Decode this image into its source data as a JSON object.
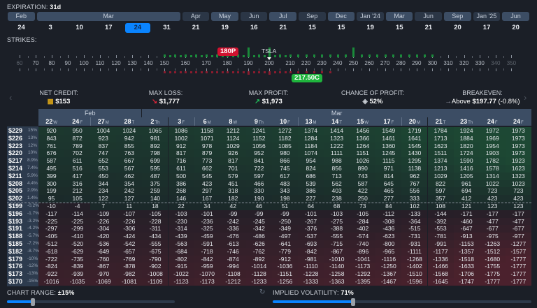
{
  "expiration": {
    "label": "EXPIRATION:",
    "value": "31d",
    "selected_index": 4,
    "months": [
      {
        "label": "Feb",
        "span": 1,
        "shade": "light"
      },
      {
        "label": "Mar",
        "span": 5,
        "shade": "light"
      },
      {
        "label": "Apr",
        "span": 1,
        "shade": "dark"
      },
      {
        "label": "May",
        "span": 1,
        "shade": "light"
      },
      {
        "label": "Jun",
        "span": 1,
        "shade": "dark"
      },
      {
        "label": "Jul",
        "span": 1,
        "shade": "light"
      },
      {
        "label": "Sep",
        "span": 1,
        "shade": "dark"
      },
      {
        "label": "Dec",
        "span": 1,
        "shade": "light"
      },
      {
        "label": "Jan '24",
        "span": 1,
        "shade": "dark"
      },
      {
        "label": "Mar",
        "span": 1,
        "shade": "light"
      },
      {
        "label": "Jun",
        "span": 1,
        "shade": "dark"
      },
      {
        "label": "Sep",
        "span": 1,
        "shade": "light"
      },
      {
        "label": "Jan '25",
        "span": 1,
        "shade": "dark"
      },
      {
        "label": "Jun",
        "span": 1,
        "shade": "light"
      }
    ],
    "dates": [
      "24",
      "3",
      "10",
      "17",
      "24",
      "31",
      "21",
      "19",
      "16",
      "21",
      "15",
      "15",
      "19",
      "15",
      "21",
      "20",
      "17",
      "20"
    ]
  },
  "strikes": {
    "label": "STRIKES:",
    "ticker": "TSLA",
    "put_tag": "180P",
    "call_tag": "217.50C",
    "ruler": [
      "60",
      "70",
      "80",
      "90",
      "100",
      "110",
      "120",
      "130",
      "140",
      "150",
      "160",
      "170",
      "180",
      "190",
      "200",
      "210",
      "220",
      "230",
      "240",
      "250",
      "260",
      "270",
      "280",
      "290",
      "300",
      "310",
      "320",
      "330",
      "340",
      "350"
    ]
  },
  "stats": [
    {
      "title": "NET CREDIT:",
      "value": "$153",
      "icon": "coins-icon"
    },
    {
      "title": "MAX LOSS:",
      "value": "$1,777",
      "icon": "arrow-down-right-icon"
    },
    {
      "title": "MAX PROFIT:",
      "value": "$1,973",
      "icon": "arrow-up-right-icon"
    },
    {
      "title": "CHANCE OF PROFIT:",
      "value": "52%",
      "icon": "dice-icon"
    },
    {
      "title": "BREAKEVEN:",
      "prefix": "Above",
      "value": "$197.77",
      "suffix": "(-0.8%)",
      "icon": "arrow-right-icon"
    }
  ],
  "colors": {
    "accent": "#0a84ff",
    "profit": "#22c55e",
    "loss": "#dc2626",
    "put_tag": "#d0122f",
    "call_tag": "#1fb53d"
  },
  "table": {
    "months": [
      {
        "label": "Feb",
        "cols": 4
      },
      {
        "label": "Mar",
        "cols": 15
      }
    ],
    "columns": [
      {
        "d": "22",
        "w": "W"
      },
      {
        "d": "24",
        "w": "F"
      },
      {
        "d": "27",
        "w": "M"
      },
      {
        "d": "28",
        "w": "T"
      },
      {
        "d": "2",
        "w": "Th"
      },
      {
        "d": "3",
        "w": "F"
      },
      {
        "d": "6",
        "w": "M"
      },
      {
        "d": "8",
        "w": "W"
      },
      {
        "d": "9",
        "w": "Th"
      },
      {
        "d": "10",
        "w": "F"
      },
      {
        "d": "13",
        "w": "M"
      },
      {
        "d": "14",
        "w": "T"
      },
      {
        "d": "15",
        "w": "W"
      },
      {
        "d": "17",
        "w": "F"
      },
      {
        "d": "20",
        "w": "M"
      },
      {
        "d": "21",
        "w": "T"
      },
      {
        "d": "23",
        "w": "Th"
      },
      {
        "d": "24",
        "w": "F"
      },
      {
        "d": "24",
        "w": "F"
      }
    ],
    "rows": [
      {
        "strike": "$229",
        "pct": "15%",
        "values": [
          920,
          950,
          1004,
          1024,
          1065,
          1086,
          1158,
          1212,
          1241,
          1272,
          1374,
          1414,
          1456,
          1549,
          1719,
          1784,
          1924,
          1972,
          1973
        ]
      },
      {
        "strike": "$226",
        "pct": "13%",
        "values": [
          843,
          872,
          923,
          942,
          981,
          1002,
          1071,
          1124,
          1152,
          1182,
          1284,
          1323,
          1366,
          1461,
          1641,
          1713,
          1884,
          1969,
          1973
        ]
      },
      {
        "strike": "$223",
        "pct": "12%",
        "values": [
          761,
          789,
          837,
          855,
          892,
          912,
          978,
          1029,
          1056,
          1085,
          1184,
          1222,
          1264,
          1360,
          1545,
          1623,
          1820,
          1954,
          1973
        ]
      },
      {
        "strike": "$220",
        "pct": "10%",
        "values": [
          676,
          702,
          747,
          763,
          798,
          817,
          879,
          926,
          952,
          980,
          1074,
          1111,
          1151,
          1245,
          1430,
          1511,
          1724,
          1903,
          1973
        ]
      },
      {
        "strike": "$217",
        "pct": "8.9%",
        "values": [
          587,
          611,
          652,
          667,
          699,
          716,
          773,
          817,
          841,
          866,
          954,
          988,
          1026,
          1115,
          1295,
          1374,
          1590,
          1782,
          1923
        ]
      },
      {
        "strike": "$214",
        "pct": "7.4%",
        "values": [
          495,
          516,
          553,
          567,
          595,
          611,
          662,
          701,
          722,
          745,
          824,
          856,
          890,
          971,
          1138,
          1213,
          1416,
          1578,
          1623
        ]
      },
      {
        "strike": "$211",
        "pct": "5.9%",
        "values": [
          399,
          417,
          450,
          462,
          487,
          500,
          545,
          579,
          597,
          617,
          686,
          713,
          743,
          814,
          962,
          1029,
          1205,
          1314,
          1323
        ]
      },
      {
        "strike": "$208",
        "pct": "4.4%",
        "values": [
          300,
          316,
          344,
          354,
          375,
          386,
          423,
          451,
          466,
          483,
          539,
          562,
          587,
          645,
          767,
          822,
          961,
          1022,
          1023
        ]
      },
      {
        "strike": "$205",
        "pct": "2.9%",
        "values": [
          199,
          212,
          234,
          242,
          259,
          268,
          297,
          318,
          330,
          343,
          386,
          403,
          422,
          465,
          556,
          597,
          694,
          723,
          723
        ]
      },
      {
        "strike": "$202",
        "pct": "1.4%",
        "values": [
          95,
          105,
          122,
          127,
          140,
          146,
          167,
          182,
          190,
          198,
          227,
          238,
          250,
          277,
          333,
          357,
          412,
          423,
          423
        ]
      },
      {
        "strike": "$199",
        "pct": "-0.2%",
        "values": [
          -10,
          -4,
          7,
          11,
          18,
          22,
          34,
          42,
          46,
          51,
          64,
          68,
          73,
          84,
          102,
          108,
          121,
          123,
          123
        ]
      },
      {
        "strike": "$196",
        "pct": "-1.7%",
        "values": [
          -117,
          -114,
          -109,
          -107,
          -105,
          -103,
          -101,
          -99,
          -99,
          -99,
          -101,
          -103,
          -105,
          -112,
          -133,
          -144,
          -171,
          -177,
          -177
        ]
      },
      {
        "strike": "$193",
        "pct": "-3.2%",
        "values": [
          -225,
          -225,
          -226,
          -226,
          -228,
          -230,
          -236,
          -242,
          -245,
          -250,
          -267,
          -275,
          -284,
          -308,
          -364,
          -392,
          -460,
          -477,
          -477
        ]
      },
      {
        "strike": "$191",
        "pct": "-4.2%",
        "values": [
          -297,
          -299,
          -304,
          -306,
          -311,
          -314,
          -325,
          -336,
          -342,
          -349,
          -376,
          -388,
          -402,
          -436,
          -515,
          -553,
          -647,
          -677,
          -677
        ]
      },
      {
        "strike": "$188",
        "pct": "-5.7%",
        "values": [
          -405,
          -410,
          -420,
          -424,
          -434,
          -439,
          -459,
          -476,
          -486,
          -497,
          -537,
          -555,
          -574,
          -623,
          -731,
          -781,
          -913,
          -975,
          -977
        ]
      },
      {
        "strike": "$185",
        "pct": "-7.2%",
        "values": [
          -512,
          -520,
          -536,
          -542,
          -555,
          -563,
          -591,
          -613,
          -626,
          -641,
          -693,
          -715,
          -740,
          -800,
          -931,
          -991,
          -1153,
          -1263,
          -1277
        ]
      },
      {
        "strike": "$182",
        "pct": "-8.7%",
        "values": [
          -618,
          -629,
          -649,
          -657,
          -675,
          -684,
          -718,
          -746,
          -762,
          -779,
          -842,
          -867,
          -896,
          -965,
          -1111,
          -1177,
          -1357,
          -1512,
          -1577
        ]
      },
      {
        "strike": "$179",
        "pct": "-10%",
        "values": [
          -722,
          -735,
          -760,
          -769,
          -790,
          -802,
          -842,
          -874,
          -892,
          -912,
          -981,
          -1010,
          -1041,
          -1116,
          -1268,
          -1336,
          -1518,
          -1680,
          -1777
        ]
      },
      {
        "strike": "$176",
        "pct": "-12%",
        "values": [
          -824,
          -839,
          -867,
          -878,
          -902,
          -915,
          -959,
          -994,
          -1014,
          -1036,
          -1110,
          -1140,
          -1173,
          -1250,
          -1402,
          -1466,
          -1633,
          -1755,
          -1777
        ]
      },
      {
        "strike": "$173",
        "pct": "-13%",
        "values": [
          -922,
          -939,
          -970,
          -982,
          -1008,
          -1022,
          -1070,
          -1108,
          -1128,
          -1151,
          -1228,
          -1258,
          -1292,
          -1367,
          -1510,
          -1568,
          -1706,
          -1775,
          -1777
        ]
      },
      {
        "strike": "$170",
        "pct": "-15%",
        "values": [
          -1016,
          -1035,
          -1069,
          -1081,
          -1109,
          -1123,
          -1173,
          -1212,
          -1233,
          -1256,
          -1333,
          -1363,
          -1395,
          -1467,
          -1596,
          -1645,
          -1747,
          -1777,
          -1777
        ]
      }
    ]
  },
  "footer": {
    "chart_range_label": "CHART RANGE:",
    "chart_range_value": "±15%",
    "chart_range_level": 0.15,
    "iv_label": "IMPLIED VOLATILITY:",
    "iv_value": "71%",
    "iv_level": 0.31
  }
}
